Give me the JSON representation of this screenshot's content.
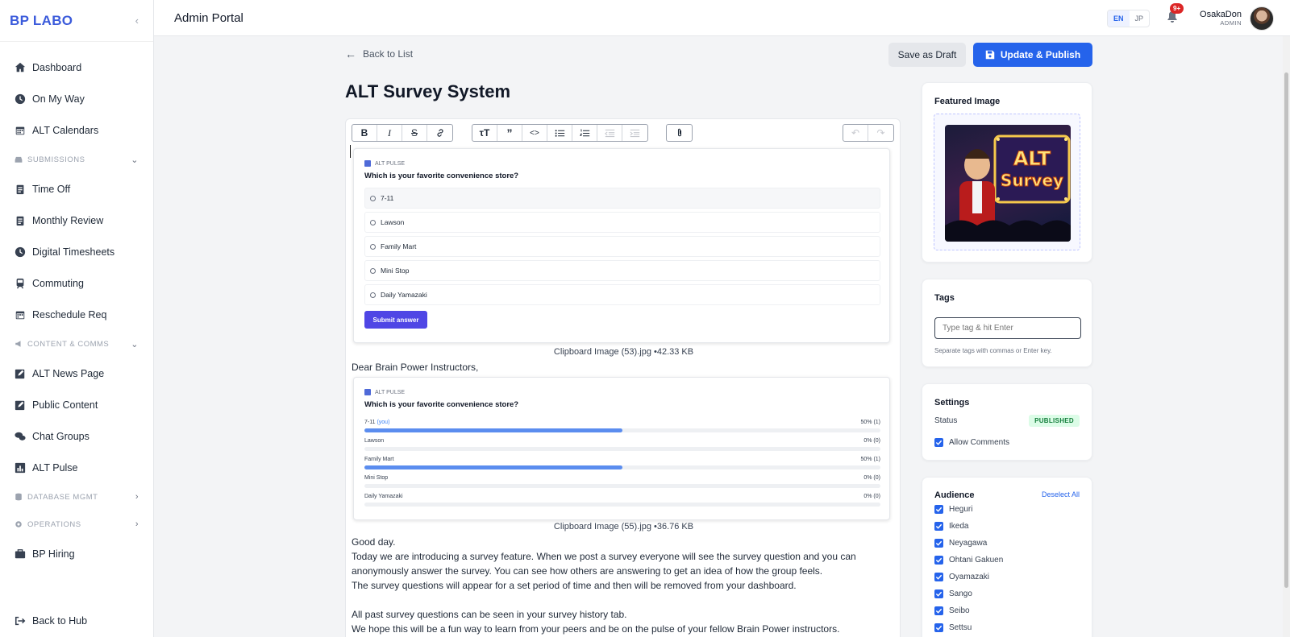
{
  "app": {
    "brand": "BP LABO",
    "portal_title": "Admin Portal"
  },
  "sidebar": {
    "items_top": [
      {
        "label": "Dashboard",
        "icon": "home-icon"
      },
      {
        "label": "On My Way",
        "icon": "clock-icon"
      },
      {
        "label": "ALT Calendars",
        "icon": "calendar-icon"
      }
    ],
    "section_submissions": "SUBMISSIONS",
    "items_submissions": [
      {
        "label": "Time Off",
        "icon": "clipboard-icon"
      },
      {
        "label": "Monthly Review",
        "icon": "clipboard-icon"
      },
      {
        "label": "Digital Timesheets",
        "icon": "clock-icon"
      },
      {
        "label": "Commuting",
        "icon": "train-icon"
      },
      {
        "label": "Reschedule Req",
        "icon": "calendar-icon"
      }
    ],
    "section_content": "CONTENT & COMMS",
    "items_content": [
      {
        "label": "ALT News Page",
        "icon": "edit-icon"
      },
      {
        "label": "Public Content",
        "icon": "edit-icon"
      },
      {
        "label": "Chat Groups",
        "icon": "chat-icon"
      },
      {
        "label": "ALT Pulse",
        "icon": "chart-icon"
      }
    ],
    "section_database": "DATABASE MGMT",
    "section_operations": "OPERATIONS",
    "item_hiring": "BP Hiring",
    "back_hub": "Back to Hub"
  },
  "topbar": {
    "lang_en": "EN",
    "lang_jp": "JP",
    "notif_count": "9+",
    "user_name": "OsakaDon",
    "user_role": "ADMIN"
  },
  "main": {
    "back_to_list": "Back to List",
    "title": "ALT Survey System",
    "save_draft": "Save as Draft",
    "update_publish": "Update & Publish"
  },
  "editor": {
    "survey1": {
      "header": "ALT PULSE",
      "question": "Which is your favorite convenience store?",
      "options": [
        "7-11",
        "Lawson",
        "Family Mart",
        "Mini Stop",
        "Daily Yamazaki"
      ],
      "submit": "Submit answer",
      "caption": "Clipboard Image (53).jpg •42.33 KB"
    },
    "greeting": "Dear Brain Power Instructors,",
    "survey2": {
      "header": "ALT PULSE",
      "question": "Which is your favorite convenience store?",
      "you_tag": "(you)",
      "results": [
        {
          "label": "7-11",
          "pct_text": "50% (1)",
          "fraction": 0.5,
          "is_you": true
        },
        {
          "label": "Lawson",
          "pct_text": "0% (0)",
          "fraction": 0,
          "is_you": false
        },
        {
          "label": "Family Mart",
          "pct_text": "50% (1)",
          "fraction": 0.5,
          "is_you": false
        },
        {
          "label": "Mini Stop",
          "pct_text": "0% (0)",
          "fraction": 0,
          "is_you": false
        },
        {
          "label": "Daily Yamazaki",
          "pct_text": "0% (0)",
          "fraction": 0,
          "is_you": false
        }
      ],
      "caption": "Clipboard Image (55).jpg •36.76 KB"
    },
    "paragraph_lines": [
      "Good day.",
      "Today we are introducing a survey feature. When we post a survey everyone will see the survey question and you can",
      "anonymously answer the survey. You can see how others are answering to get an idea of how the group feels.",
      "The survey questions will appear for a set period of time and then will be removed from your dashboard.",
      "",
      "All past survey questions can be seen in your survey history tab.",
      "We hope this will be a fun way to learn from your peers and be on the pulse of your fellow Brain Power instructors."
    ]
  },
  "featured": {
    "title": "Featured Image",
    "image_text_1": "ALT",
    "image_text_2": "Survey"
  },
  "tags": {
    "title": "Tags",
    "placeholder": "Type tag & hit Enter",
    "help": "Separate tags with commas or Enter key."
  },
  "settings": {
    "title": "Settings",
    "status_label": "Status",
    "status_value": "PUBLISHED",
    "allow_comments": "Allow Comments"
  },
  "audience": {
    "title": "Audience",
    "deselect_all": "Deselect All",
    "items": [
      "Heguri",
      "Ikeda",
      "Neyagawa",
      "Ohtani Gakuen",
      "Oyamazaki",
      "Sango",
      "Seibo",
      "Settsu"
    ]
  },
  "colors": {
    "brand": "#3b5bdb",
    "primary": "#2563eb",
    "badge": "#dc2626",
    "published_bg": "#dcfce7",
    "published_text": "#15803d"
  }
}
